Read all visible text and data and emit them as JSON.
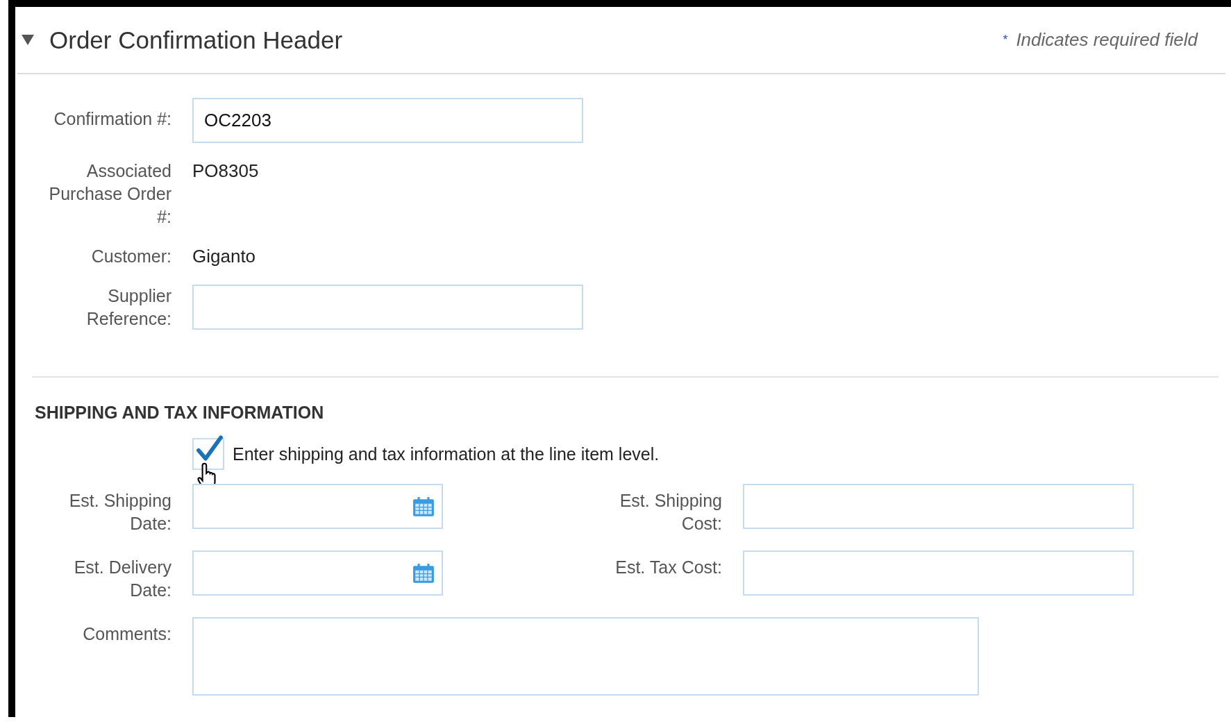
{
  "header": {
    "title": "Order Confirmation Header",
    "expanded": true,
    "required_mark": "*",
    "required_note": "Indicates required field"
  },
  "fields": [
    {
      "label": "Confirmation #:",
      "kind": "input",
      "value": "OC2203"
    },
    {
      "label": "Associated Purchase Order #:",
      "kind": "text",
      "value": "PO8305"
    },
    {
      "label": "Customer:",
      "kind": "text",
      "value": "Giganto"
    },
    {
      "label": "Supplier Reference:",
      "kind": "input"
    }
  ],
  "section": {
    "title": "SHIPPING AND TAX INFORMATION",
    "checkbox": {
      "label": "Enter shipping and tax information at the line item level.",
      "checked": true
    },
    "rows": [
      {
        "fields": [
          {
            "label": "Est. Shipping Date:",
            "kind": "date"
          },
          {
            "label": "Est. Shipping Cost:",
            "kind": "input"
          }
        ]
      },
      {
        "fields": [
          {
            "label": "Est. Delivery Date:",
            "kind": "date"
          },
          {
            "label": "Est. Tax Cost:",
            "kind": "input"
          }
        ]
      },
      {
        "fields": [
          {
            "label": "Comments:",
            "kind": "textarea"
          }
        ]
      }
    ]
  }
}
